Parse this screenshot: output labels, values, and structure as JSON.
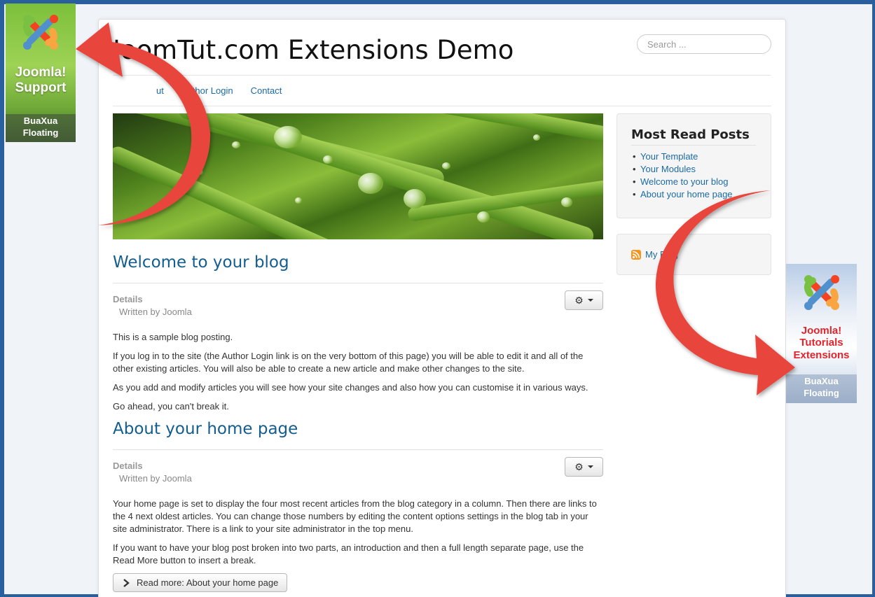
{
  "site": {
    "title": "JoomTut.com Extensions Demo"
  },
  "search": {
    "placeholder": "Search ..."
  },
  "nav": {
    "items": [
      {
        "label": "ut"
      },
      {
        "label": "Author Login"
      },
      {
        "label": "Contact"
      }
    ]
  },
  "articles": [
    {
      "title": "Welcome to your blog",
      "details_label": "Details",
      "written_by": "Written by Joomla",
      "paragraphs": [
        "This is a sample blog posting.",
        "If you log in to the site (the Author Login link is on the very bottom of this page) you will be able to edit it and all of the other existing articles. You will also be able to create a new article and make other changes to the site.",
        "As you add and modify articles you will see how your site changes and also how you can customise it in various ways.",
        "Go ahead, you can't break it."
      ]
    },
    {
      "title": "About your home page",
      "details_label": "Details",
      "written_by": "Written by Joomla",
      "paragraphs": [
        "Your home page is set to display the four most recent articles from the blog category in a column. Then there are links to the 4 next oldest articles. You can change those numbers by editing the content options settings in the blog tab in your site administrator. There is a link to your site administrator in the top menu.",
        "If you want to have your blog post broken into two parts, an introduction and then a full length separate page, use the Read More button to insert a break."
      ],
      "read_more": "Read more: About your home page"
    }
  ],
  "sidebar": {
    "most_read": {
      "title": "Most Read Posts",
      "items": [
        {
          "label": "Your Template"
        },
        {
          "label": "Your Modules"
        },
        {
          "label": "Welcome to your blog"
        },
        {
          "label": "About your home page"
        }
      ]
    },
    "feed": {
      "label": "My Blog"
    }
  },
  "badges": {
    "left": {
      "main": "Joomla! Support",
      "sub": "BuaXua Floating",
      "accent": "#7cc03b"
    },
    "right": {
      "main": "Joomla! Tutorials Extensions",
      "sub": "BuaXua Floating",
      "accent": "#e3242b"
    }
  },
  "icons": {
    "gear": "gear-icon",
    "caret": "caret-down-icon",
    "chevron": "chevron-right-icon",
    "rss": "rss-icon",
    "joomla": "joomla-logo-icon"
  },
  "colors": {
    "link": "#1b6aa5",
    "heading": "#135d8f",
    "arrow": "#e8453c",
    "frame": "#2a5f9e"
  }
}
